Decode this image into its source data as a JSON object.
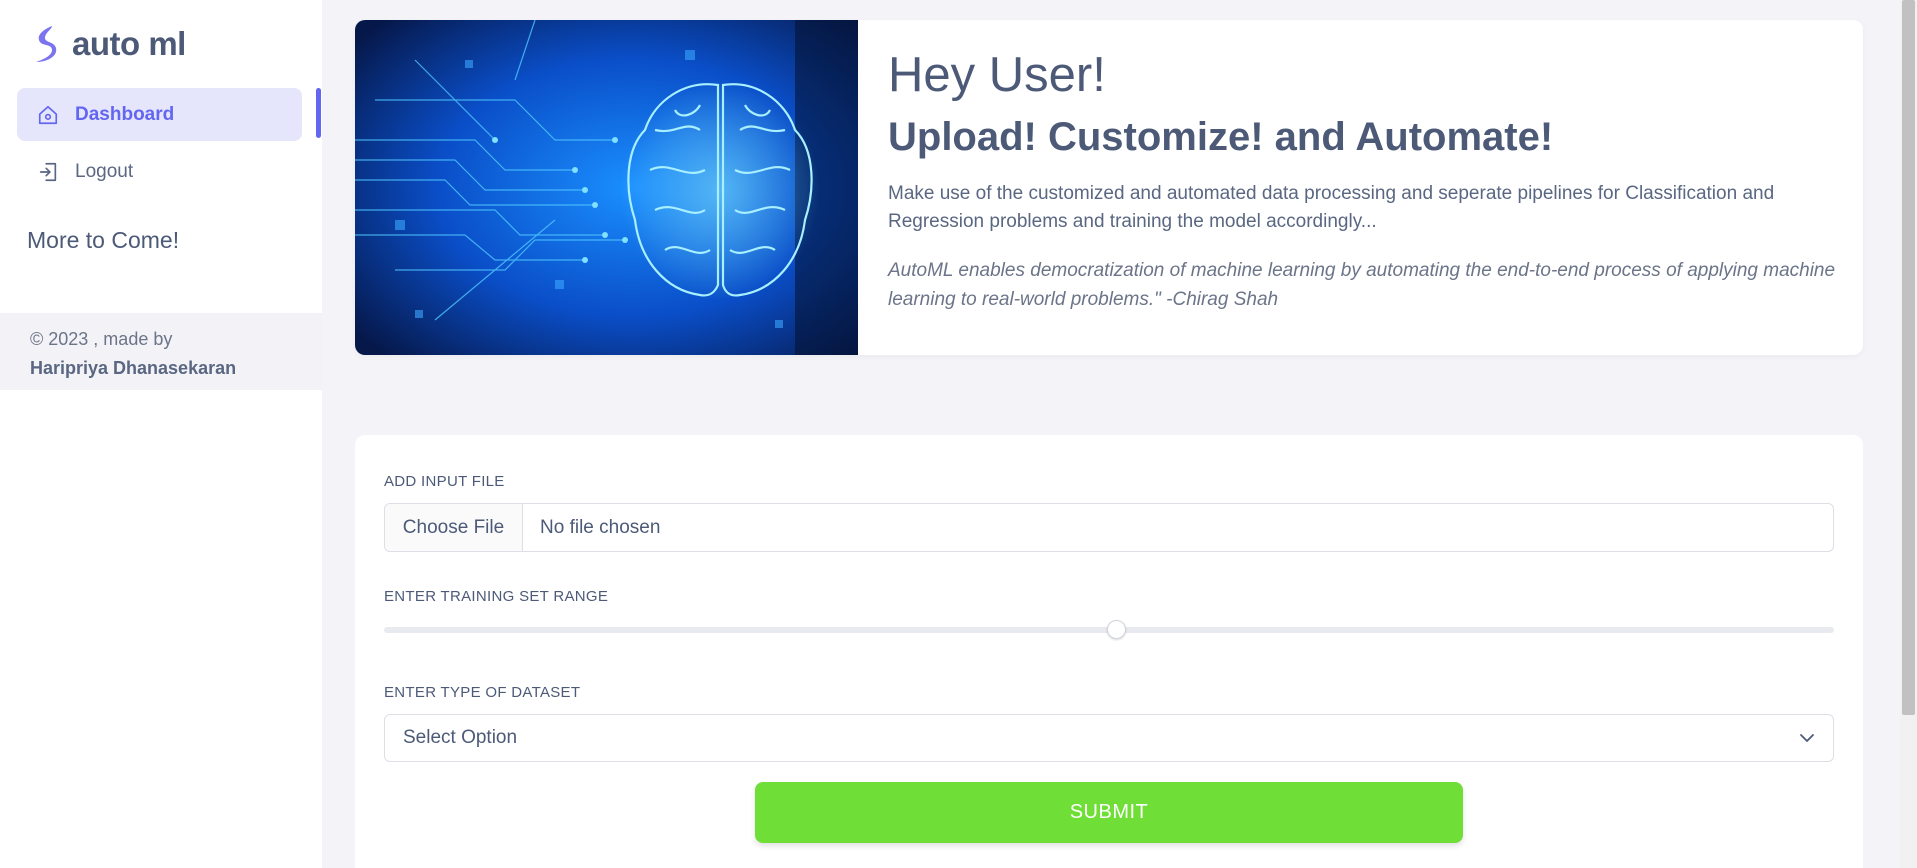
{
  "brand": {
    "name": "auto ml"
  },
  "sidebar": {
    "items": [
      {
        "label": "Dashboard",
        "icon": "home-icon",
        "active": true
      },
      {
        "label": "Logout",
        "icon": "logout-icon",
        "active": false
      }
    ],
    "more": "More to Come!",
    "footer": {
      "text": "© 2023 , made by",
      "author": "Haripriya Dhanasekaran"
    }
  },
  "hero": {
    "title": "Hey User!",
    "subtitle": "Upload! Customize! and Automate!",
    "description": "Make use of the customized and automated data processing and seperate pipelines for Classification and Regression problems and training the model accordingly...",
    "quote": "AutoML enables democratization of machine learning by automating the end-to-end process of applying machine learning to real-world problems.\" -Chirag Shah"
  },
  "form": {
    "file_label": "ADD INPUT FILE",
    "file_button": "Choose File",
    "file_status": "No file chosen",
    "range_label": "ENTER TRAINING SET RANGE",
    "range_value": 0.505,
    "dataset_label": "ENTER TYPE OF DATASET",
    "dataset_selected": "Select Option",
    "submit_label": "SUBMIT"
  },
  "colors": {
    "accent": "#6366f1",
    "submit": "#6fdf37",
    "text": "#4c5a78"
  }
}
